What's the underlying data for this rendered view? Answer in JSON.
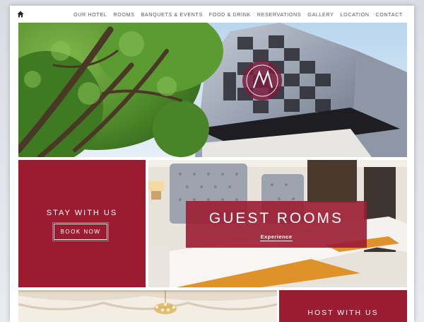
{
  "nav": {
    "home_icon": "home-icon",
    "items": [
      {
        "label": "OUR HOTEL"
      },
      {
        "label": "ROOMS"
      },
      {
        "label": "BANQUETS & EVENTS"
      },
      {
        "label": "FOOD & DRINK"
      },
      {
        "label": "RESERVATIONS"
      },
      {
        "label": "GALLERY"
      },
      {
        "label": "LOCATION"
      },
      {
        "label": "CONTACT"
      }
    ]
  },
  "panels": {
    "stay": {
      "title": "STAY WITH US",
      "button": "BOOK NOW"
    },
    "rooms": {
      "title": "GUEST ROOMS",
      "link": "Experience"
    },
    "host": {
      "title": "HOST WITH US"
    }
  },
  "colors": {
    "brand": "#9b1c31",
    "nav_text": "#555555"
  }
}
